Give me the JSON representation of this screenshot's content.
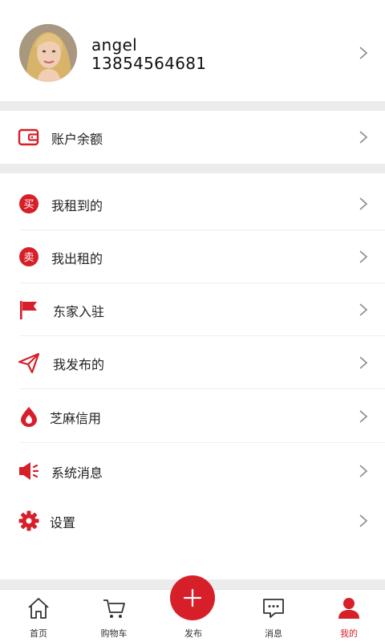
{
  "profile": {
    "name": "angel",
    "phone": "13854564681"
  },
  "menu": {
    "balance": "账户余额",
    "rented_in": "我租到的",
    "rented_in_badge": "买",
    "rented_out": "我出租的",
    "rented_out_badge": "卖",
    "merchant_join": "东家入驻",
    "my_posts": "我发布的",
    "zhima_credit": "芝麻信用",
    "system_messages": "系统消息",
    "settings": "设置"
  },
  "tabbar": {
    "home": "首页",
    "cart": "购物车",
    "publish": "发布",
    "messages": "消息",
    "mine": "我的"
  },
  "colors": {
    "accent": "#d71f29",
    "separator": "#ececec"
  }
}
